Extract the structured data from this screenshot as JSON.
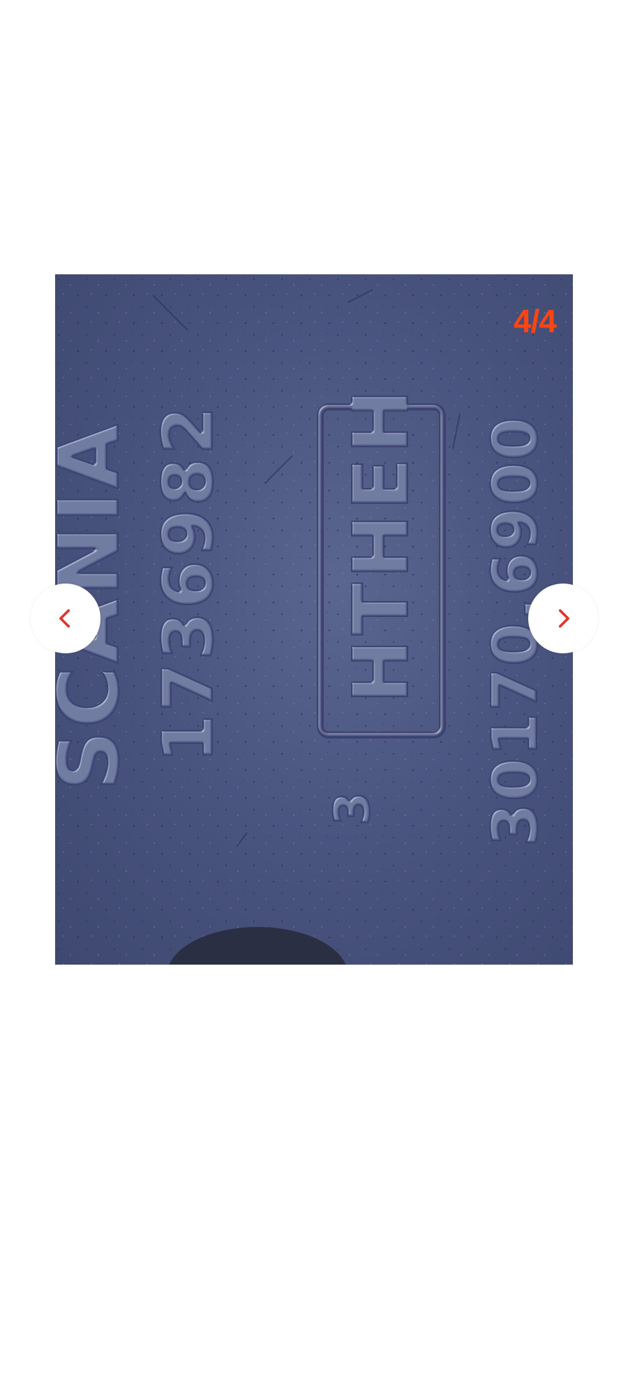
{
  "gallery": {
    "counter": "4/4",
    "counter_color": "#ff4411",
    "prev_icon": "chevron-left-icon",
    "next_icon": "chevron-right-icon",
    "arrow_color": "#e0352b"
  },
  "photo": {
    "embossed_text": {
      "brand": "SCANIA",
      "part_number": "1736982",
      "stamp_box": "HTHEH",
      "code_right": "30170.6900",
      "code_bottom": "3"
    }
  }
}
